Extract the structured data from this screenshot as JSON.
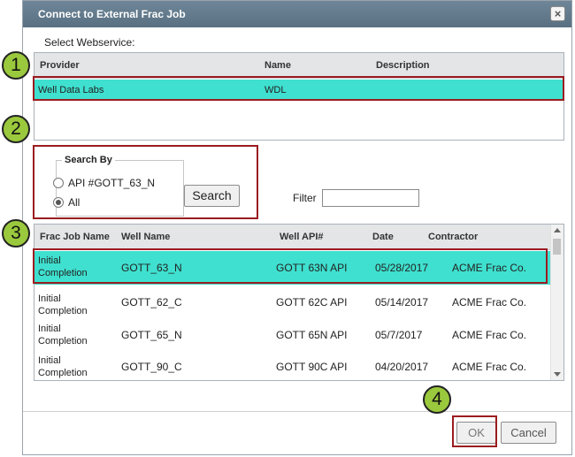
{
  "dialog": {
    "title": "Connect to External Frac Job",
    "close_glyph": "×",
    "select_webservice_label": "Select Webservice:"
  },
  "webservice_grid": {
    "columns": [
      "Provider",
      "Name",
      "Description"
    ],
    "rows": [
      {
        "provider": "Well Data Labs",
        "name": "WDL",
        "description": "",
        "selected": true
      }
    ]
  },
  "search_by": {
    "legend": "Search By",
    "options": [
      {
        "label": "API #GOTT_63_N",
        "checked": false
      },
      {
        "label": "All",
        "checked": true
      }
    ],
    "search_button": "Search"
  },
  "filter": {
    "label": "Filter",
    "value": ""
  },
  "jobs_grid": {
    "columns": [
      "Frac Job Name",
      "Well Name",
      "Well API#",
      "Date",
      "Contractor"
    ],
    "rows": [
      {
        "job": "Initial Completion",
        "well": "GOTT_63_N",
        "api": "GOTT 63N API",
        "date": "05/28/2017",
        "contractor": "ACME Frac Co.",
        "selected": true
      },
      {
        "job": "Initial Completion",
        "well": "GOTT_62_C",
        "api": "GOTT 62C API",
        "date": "05/14/2017",
        "contractor": "ACME Frac Co.",
        "selected": false
      },
      {
        "job": "Initial Completion",
        "well": "GOTT_65_N",
        "api": "GOTT 65N API",
        "date": "05/7/2017",
        "contractor": "ACME Frac Co.",
        "selected": false
      },
      {
        "job": "Initial Completion",
        "well": "GOTT_90_C",
        "api": "GOTT 90C API",
        "date": "04/20/2017",
        "contractor": "ACME Frac Co.",
        "selected": false
      }
    ]
  },
  "footer": {
    "ok": "OK",
    "cancel": "Cancel"
  },
  "callouts": {
    "badge_1": "1",
    "badge_2": "2",
    "badge_3": "3",
    "badge_4": "4"
  },
  "colors": {
    "title_bar": "#587082",
    "selection": "#3fe0cf",
    "callout_border": "#9b1c20",
    "badge_fill": "#9bc93d"
  }
}
